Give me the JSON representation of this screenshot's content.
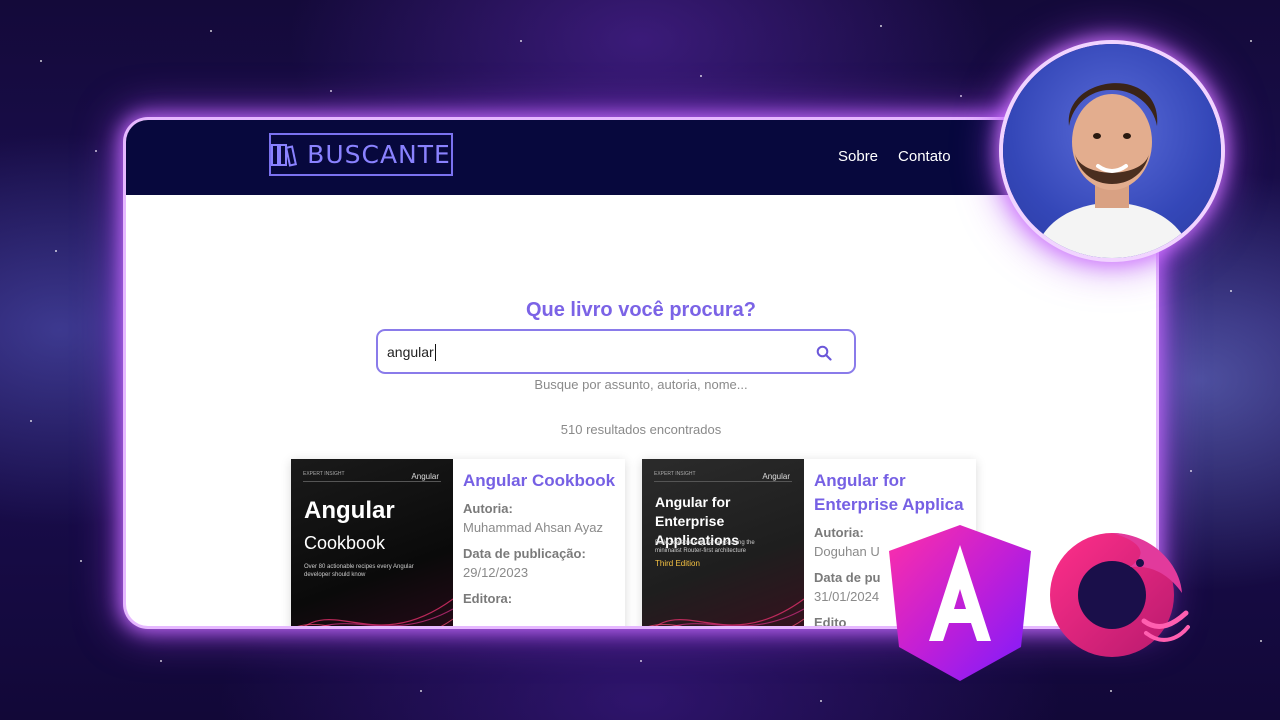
{
  "header": {
    "logo_text": "BUSCANTE",
    "nav": [
      "Sobre",
      "Contato"
    ]
  },
  "search": {
    "title": "Que livro você procura?",
    "value": "angular",
    "hint": "Busque por assunto, autoria, nome..."
  },
  "results_text": "510 resultados encontrados",
  "books": [
    {
      "title": "Angular Cookbook",
      "author_label": "Autoria:",
      "author": "Muhammad Ahsan Ayaz",
      "date_label": "Data de publicação:",
      "date": "29/12/2023",
      "publisher_label": "Editora:",
      "cover": {
        "top": "EXPERT INSIGHT",
        "brand": "Angular",
        "title": "Angular",
        "subtitle": "Cookbook",
        "blurb": "Over 80 actionable recipes every Angular developer should know"
      }
    },
    {
      "title": "Angular for Enterprise Applica",
      "author_label": "Autoria:",
      "author": "Doguhan U",
      "date_label": "Data de pu",
      "date": "31/01/2024",
      "publisher_label": "Edito",
      "cover": {
        "top": "EXPERT INSIGHT",
        "brand": "Angular",
        "title": "Angular for Enterprise Applications",
        "blurb": "Build scalable Angular apps using the minimalist Router-first architecture",
        "edition": "Third Edition"
      }
    }
  ],
  "colors": {
    "navbar": "#07083d",
    "accent": "#7b63e6",
    "glow": "#c86eff"
  }
}
